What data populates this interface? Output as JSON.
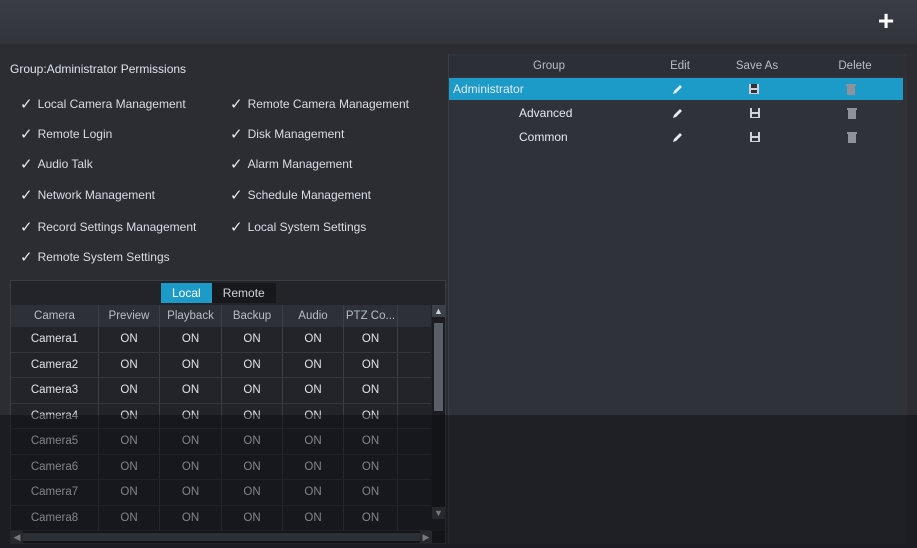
{
  "topbar": {
    "add_icon": "plus-icon"
  },
  "permissions": {
    "group_title": "Group:Administrator Permissions",
    "items": [
      "Local Camera Management",
      "Remote Camera Management",
      "Remote Login",
      "Disk Management",
      "Audio Talk",
      "Alarm Management",
      "Network Management",
      "Schedule Management",
      "Record Settings Management",
      "Local System Settings",
      "Remote System Settings"
    ]
  },
  "camera_table": {
    "tabs": [
      "Local",
      "Remote"
    ],
    "active_tab": "Local",
    "columns": [
      "Camera",
      "Preview",
      "Playback",
      "Backup",
      "Audio",
      "PTZ Co..."
    ],
    "rows": [
      [
        "Camera1",
        "ON",
        "ON",
        "ON",
        "ON",
        "ON"
      ],
      [
        "Camera2",
        "ON",
        "ON",
        "ON",
        "ON",
        "ON"
      ],
      [
        "Camera3",
        "ON",
        "ON",
        "ON",
        "ON",
        "ON"
      ],
      [
        "Camera4",
        "ON",
        "ON",
        "ON",
        "ON",
        "ON"
      ],
      [
        "Camera5",
        "ON",
        "ON",
        "ON",
        "ON",
        "ON"
      ],
      [
        "Camera6",
        "ON",
        "ON",
        "ON",
        "ON",
        "ON"
      ],
      [
        "Camera7",
        "ON",
        "ON",
        "ON",
        "ON",
        "ON"
      ],
      [
        "Camera8",
        "ON",
        "ON",
        "ON",
        "ON",
        "ON"
      ]
    ]
  },
  "groups": {
    "columns": [
      "Group",
      "Edit",
      "Save As",
      "Delete"
    ],
    "rows": [
      {
        "name": "Administrator",
        "selected": true
      },
      {
        "name": "Advanced",
        "selected": false
      },
      {
        "name": "Common",
        "selected": false
      }
    ]
  },
  "colors": {
    "accent": "#1d9bc8",
    "background": "#2b2d33"
  }
}
